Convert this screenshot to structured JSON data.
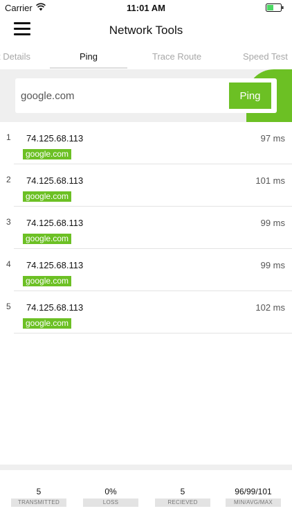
{
  "status_bar": {
    "carrier": "Carrier",
    "time": "11:01 AM",
    "battery_color": "#4cd964"
  },
  "header": {
    "title": "Network Tools",
    "menu_icon": "hamburger-menu-icon"
  },
  "tabs": [
    {
      "label": "t Details",
      "active": false
    },
    {
      "label": "Ping",
      "active": true
    },
    {
      "label": "Trace Route",
      "active": false
    },
    {
      "label": "Speed Test",
      "active": false
    }
  ],
  "search": {
    "value": "google.com",
    "button_label": "Ping"
  },
  "results": [
    {
      "index": "1",
      "ip": "74.125.68.113",
      "time": "97 ms",
      "host": "google.com"
    },
    {
      "index": "2",
      "ip": "74.125.68.113",
      "time": "101 ms",
      "host": "google.com"
    },
    {
      "index": "3",
      "ip": "74.125.68.113",
      "time": "99 ms",
      "host": "google.com"
    },
    {
      "index": "4",
      "ip": "74.125.68.113",
      "time": "99 ms",
      "host": "google.com"
    },
    {
      "index": "5",
      "ip": "74.125.68.113",
      "time": "102 ms",
      "host": "google.com"
    }
  ],
  "stats": [
    {
      "value": "5",
      "label": "TRANSMITTED"
    },
    {
      "value": "0%",
      "label": "LOSS"
    },
    {
      "value": "5",
      "label": "RECIEVED"
    },
    {
      "value": "96/99/101",
      "label": "MIN/AVG/MAX"
    }
  ],
  "colors": {
    "accent": "#6cc024",
    "background_gray": "#efefef"
  }
}
